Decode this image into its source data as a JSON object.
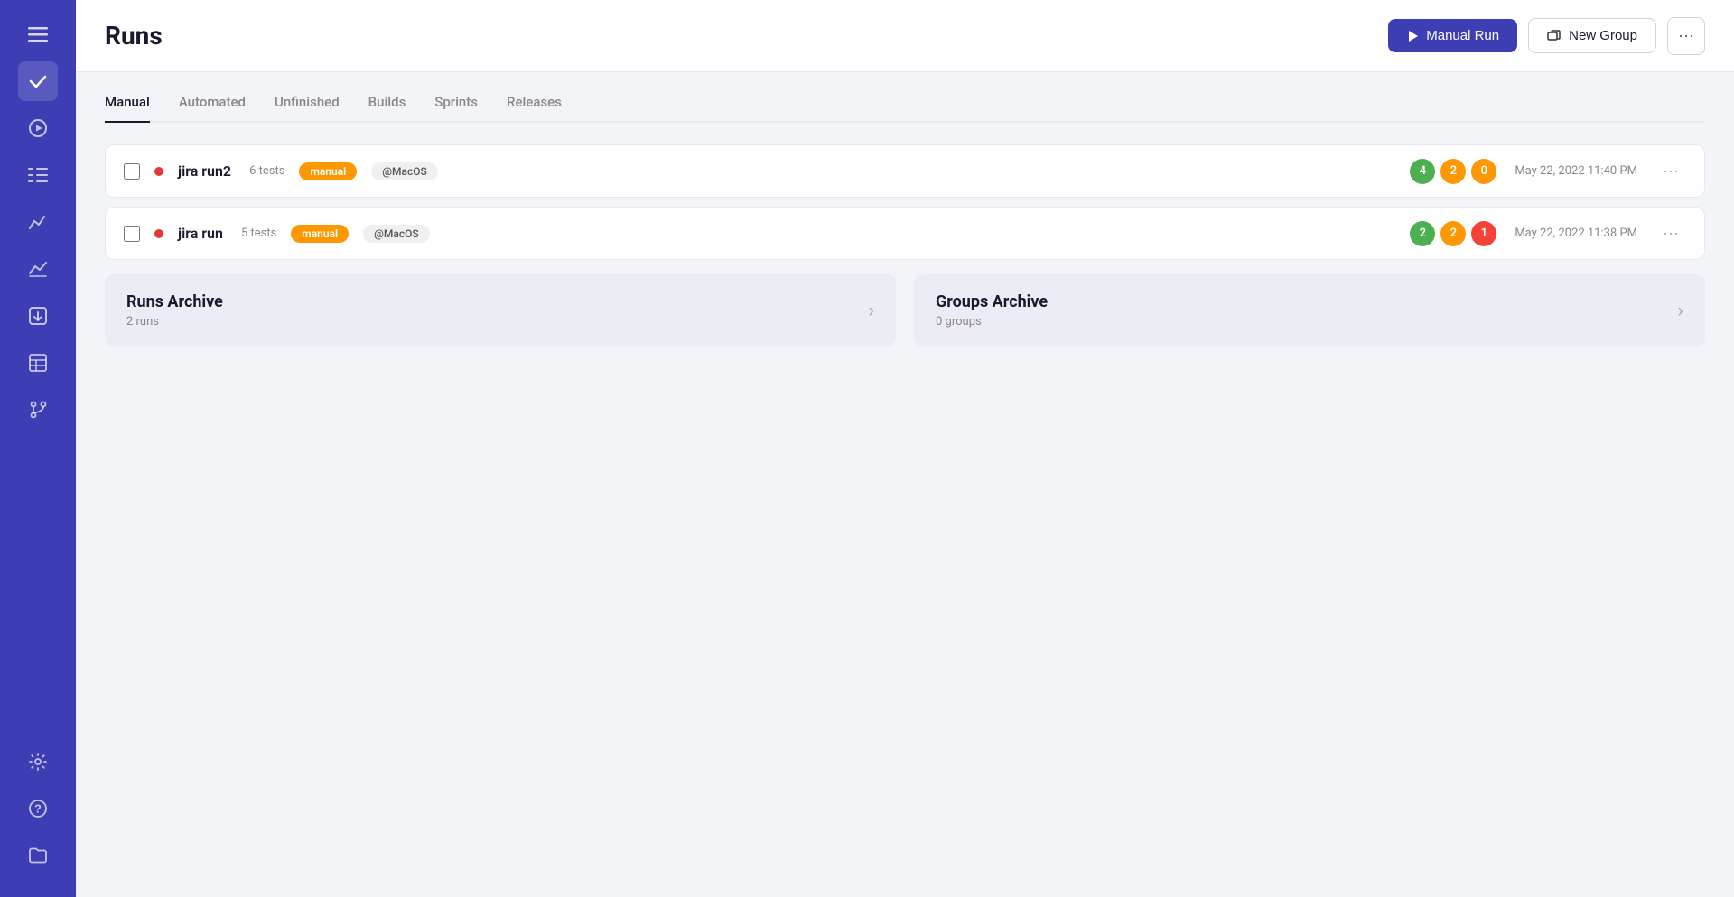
{
  "sidebar": {
    "icons": [
      {
        "name": "menu-icon",
        "symbol": "☰",
        "active": false
      },
      {
        "name": "check-icon",
        "symbol": "✓",
        "active": true
      },
      {
        "name": "play-circle-icon",
        "symbol": "⊙",
        "active": false
      },
      {
        "name": "list-icon",
        "symbol": "≡",
        "active": false
      },
      {
        "name": "chart-line-icon",
        "symbol": "∕",
        "active": false
      },
      {
        "name": "analytics-icon",
        "symbol": "⌇",
        "active": false
      },
      {
        "name": "import-icon",
        "symbol": "⬒",
        "active": false
      },
      {
        "name": "table-icon",
        "symbol": "▦",
        "active": false
      },
      {
        "name": "git-icon",
        "symbol": "⎇",
        "active": false
      }
    ],
    "bottom_icons": [
      {
        "name": "settings-icon",
        "symbol": "⚙",
        "active": false
      },
      {
        "name": "help-icon",
        "symbol": "?",
        "active": false
      },
      {
        "name": "folder-icon",
        "symbol": "📁",
        "active": false
      }
    ]
  },
  "header": {
    "title": "Runs",
    "manual_run_label": "Manual Run",
    "new_group_label": "New Group",
    "more_label": "···"
  },
  "tabs": [
    {
      "label": "Manual",
      "active": true
    },
    {
      "label": "Automated",
      "active": false
    },
    {
      "label": "Unfinished",
      "active": false
    },
    {
      "label": "Builds",
      "active": false
    },
    {
      "label": "Sprints",
      "active": false
    },
    {
      "label": "Releases",
      "active": false
    }
  ],
  "runs": [
    {
      "name": "jira run2",
      "tests_count": "6 tests",
      "badge": "manual",
      "env": "@MacOS",
      "stats": {
        "green": 4,
        "orange": 2,
        "red": 0
      },
      "timestamp": "May 22, 2022 11:40 PM",
      "status": "red"
    },
    {
      "name": "jira run",
      "tests_count": "5 tests",
      "badge": "manual",
      "env": "@MacOS",
      "stats": {
        "green": 2,
        "orange": 2,
        "red": 1
      },
      "timestamp": "May 22, 2022 11:38 PM",
      "status": "red"
    }
  ],
  "archive": {
    "runs": {
      "title": "Runs Archive",
      "subtitle": "2 runs"
    },
    "groups": {
      "title": "Groups Archive",
      "subtitle": "0 groups"
    }
  }
}
